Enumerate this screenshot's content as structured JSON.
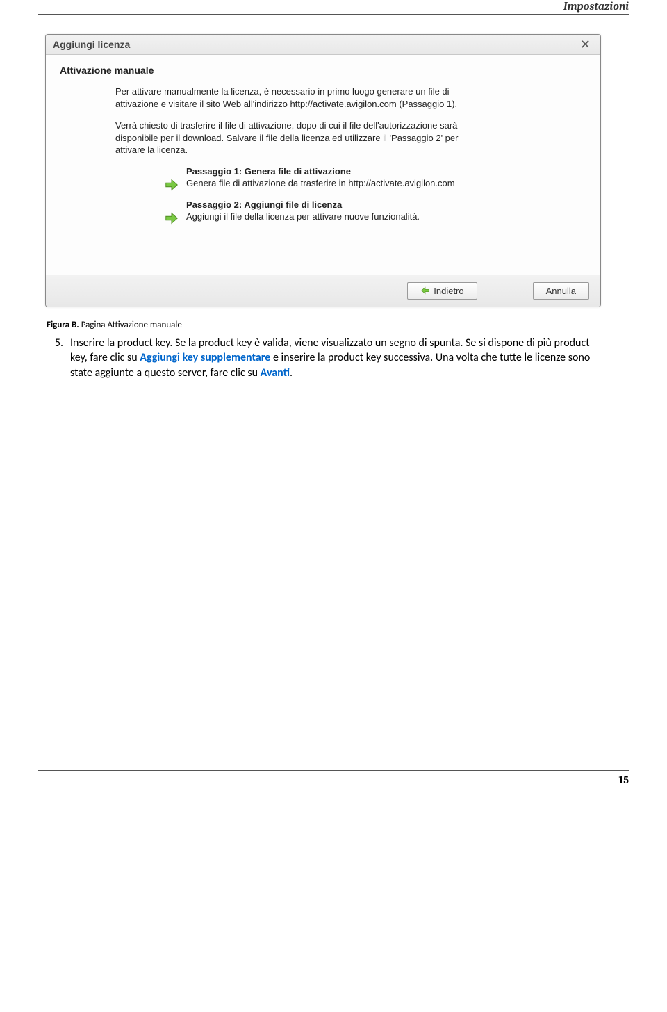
{
  "header": {
    "section_title": "Impostazioni"
  },
  "dialog": {
    "title": "Aggiungi licenza",
    "close_glyph": "✕",
    "subtitle": "Attivazione manuale",
    "para1": "Per attivare manualmente la licenza, è necessario in primo luogo generare un file di attivazione e visitare il sito Web all'indirizzo http://activate.avigilon.com (Passaggio 1).",
    "para2": "Verrà chiesto di trasferire il file di attivazione, dopo di cui il file dell'autorizzazione sarà disponibile per il download. Salvare il file della licenza ed utilizzare il 'Passaggio 2' per attivare la licenza.",
    "step1": {
      "title": "Passaggio 1: Genera file di attivazione",
      "body": "Genera file di attivazione da trasferire in http://activate.avigilon.com"
    },
    "step2": {
      "title": "Passaggio 2: Aggiungi file di licenza",
      "body": "Aggiungi il file della licenza per attivare nuove funzionalità."
    },
    "buttons": {
      "back": "Indietro",
      "cancel": "Annulla"
    }
  },
  "caption": {
    "label": "Figura B.",
    "text": " Pagina Attivazione manuale"
  },
  "item5": {
    "num": "5.",
    "text_a": "Inserire la product key. Se la product key è valida, viene visualizzato un segno di spunta. Se si dispone di più product key, fare clic su ",
    "link1": "Aggiungi key supplementare",
    "text_b": " e inserire la product key successiva. Una volta che tutte le licenze sono state aggiunte a questo server, fare clic su ",
    "link2": "Avanti",
    "text_c": "."
  },
  "footer": {
    "page": "15"
  }
}
